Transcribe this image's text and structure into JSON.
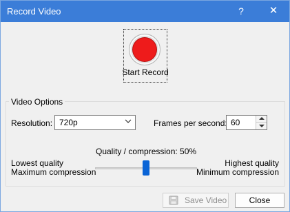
{
  "window": {
    "title": "Record Video",
    "help_glyph": "?",
    "close_glyph": "✕"
  },
  "record": {
    "label": "Start Record",
    "color": "#ee1b1b"
  },
  "video_options": {
    "group_label": "Video Options",
    "resolution_label": "Resolution:",
    "resolution_value": "720p",
    "fps_label": "Frames per second:",
    "fps_value": "60",
    "quality_caption": "Quality / compression: 50%",
    "quality_value": 0.5,
    "left_line1": "Lowest quality",
    "left_line2": "Maximum compression",
    "right_line1": "Highest quality",
    "right_line2": "Minimum compression"
  },
  "buttons": {
    "save_label": "Save Video",
    "close_label": "Close"
  },
  "colors": {
    "titlebar": "#3b7dd8",
    "accent": "#0a64d6"
  }
}
